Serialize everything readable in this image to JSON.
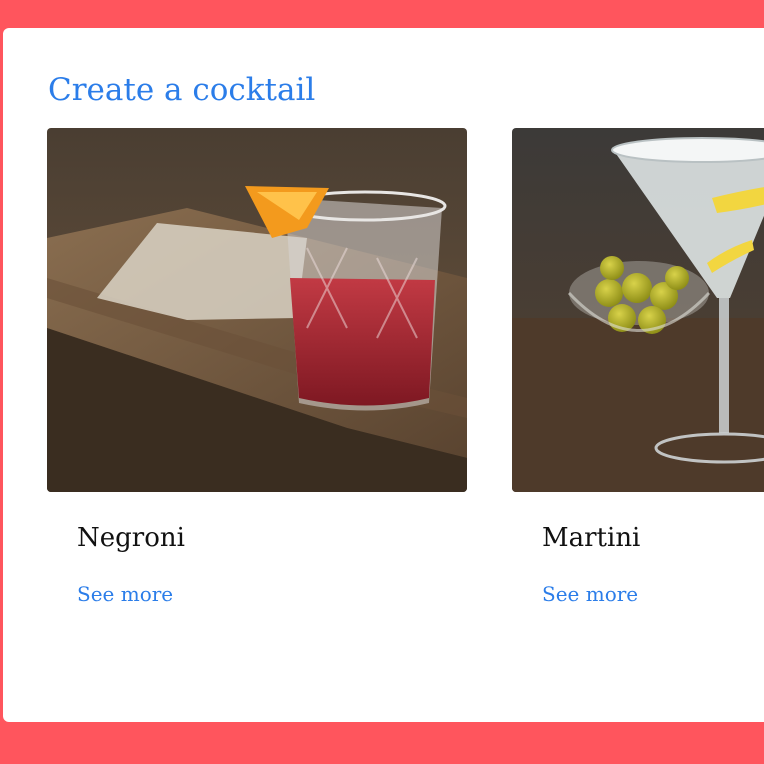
{
  "page": {
    "title": "Create a cocktail"
  },
  "cards": [
    {
      "name": "Negroni",
      "link_label": "See more",
      "image_alt": "negroni-photo"
    },
    {
      "name": "Martini",
      "link_label": "See more",
      "image_alt": "martini-photo"
    }
  ],
  "colors": {
    "page_background": "#ff555d",
    "panel_background": "#ffffff",
    "accent": "#2b7de9",
    "card_name": "#111111"
  }
}
